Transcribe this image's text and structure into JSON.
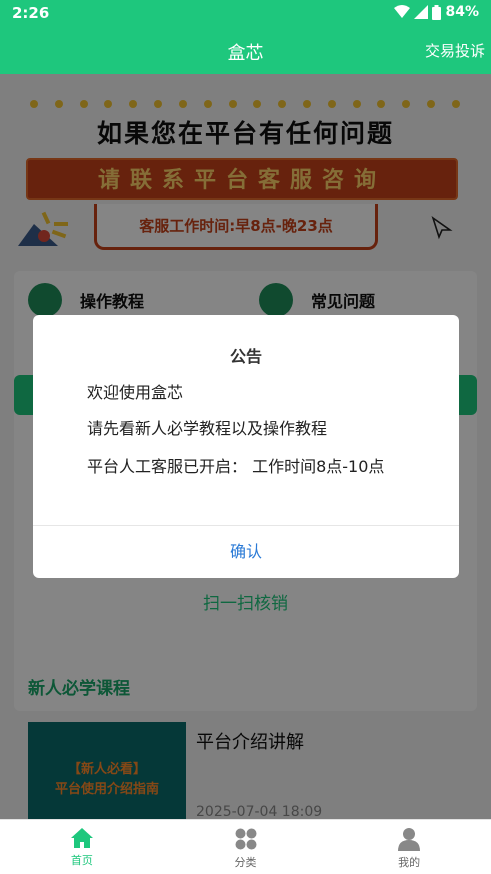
{
  "status": {
    "time": "2:26",
    "battery": "84%"
  },
  "appbar": {
    "title": "盒芯",
    "action": "交易投诉"
  },
  "banner": {
    "headline": "如果您在平台有任何问题",
    "contact": "请联系平台客服咨询",
    "hours": "客服工作时间:早8点-晚23点"
  },
  "quick": [
    {
      "label": "操作教程",
      "icon": "book-icon"
    },
    {
      "label": "常见问题",
      "icon": "question-icon"
    }
  ],
  "scan_label": "扫一扫核销",
  "newbie": {
    "section_title": "新人必学课程",
    "course_title": "平台介绍讲解",
    "course_date": "2025-07-04 18:09",
    "thumb_line1": "【新人必看】",
    "thumb_line2": "平台使用介绍指南"
  },
  "dialog": {
    "title": "公告",
    "lines": [
      "欢迎使用盒芯",
      "请先看新人必学教程以及操作教程",
      "平台人工客服已开启： 工作时间8点-10点"
    ],
    "confirm": "确认"
  },
  "tabs": [
    {
      "label": "首页",
      "icon": "home-icon",
      "active": true
    },
    {
      "label": "分类",
      "icon": "category-icon",
      "active": false
    },
    {
      "label": "我的",
      "icon": "user-icon",
      "active": false
    }
  ],
  "colors": {
    "brand": "#1ec77d",
    "link": "#2a7ad6",
    "banner_red": "#c6421a"
  }
}
